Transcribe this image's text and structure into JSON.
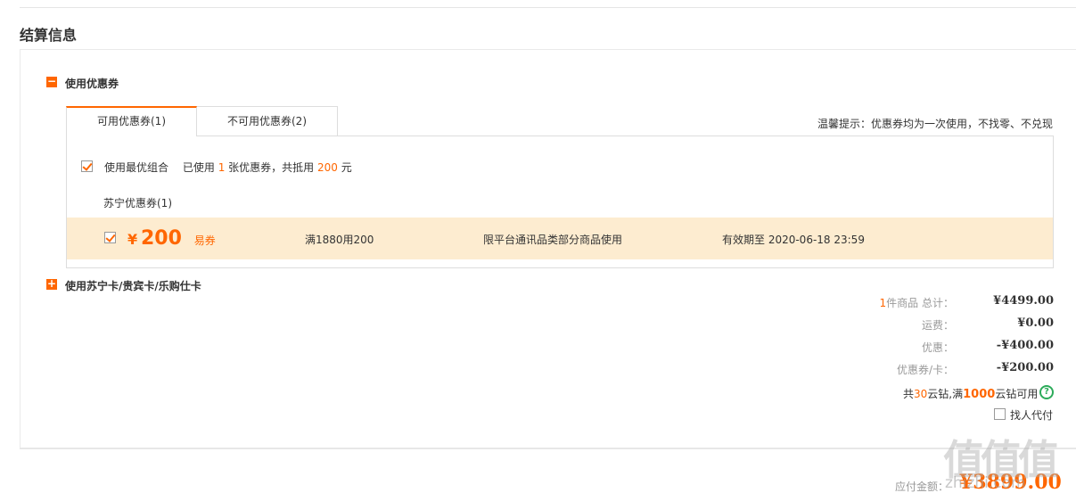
{
  "section": {
    "title": "结算信息"
  },
  "coupon_section": {
    "toggle_symbol": "−",
    "label": "使用优惠券",
    "tabs": [
      {
        "label": "可用优惠券(1)",
        "active": true
      },
      {
        "label": "不可用优惠券(2)",
        "active": false
      }
    ],
    "hint": "温馨提示：优惠券均为一次使用，不找零、不兑现",
    "best_combo": {
      "label": "使用最优组合",
      "used_prefix": "已使用",
      "used_count": "1",
      "used_mid": "张优惠券，共抵用",
      "used_amount": "200",
      "used_suffix": "元",
      "checked": true
    },
    "group_title": "苏宁优惠券(1)",
    "coupon": {
      "checked": true,
      "yen": "¥",
      "amount": "200",
      "tag": "易券",
      "condition": "满1880用200",
      "scope": "限平台通讯品类部分商品使用",
      "validity": "有效期至 2020-06-18 23:59"
    }
  },
  "card_section": {
    "toggle_symbol": "+",
    "label": "使用苏宁卡/贵宾卡/乐购仕卡"
  },
  "summary": {
    "items_count": "1",
    "items_label": "件商品 总计：",
    "items_total": "¥4499.00",
    "shipping_label": "运费：",
    "shipping": "¥0.00",
    "discount_label": "优惠：",
    "discount": "-¥400.00",
    "coupon_label": "优惠券/卡：",
    "coupon": "-¥200.00",
    "yunzuan_prefix": "共",
    "yunzuan_count": "30",
    "yunzuan_mid": "云钻,满",
    "yunzuan_threshold": "1000",
    "yunzuan_suffix": "云钻可用",
    "help_symbol": "?",
    "proxy_pay_label": "找人代付"
  },
  "payment": {
    "label": "应付金额：",
    "amount": "¥3899.00"
  },
  "watermark": {
    "glyphs": "值值值",
    "site": "zhizhi.com"
  },
  "colors": {
    "accent": "#ff6600",
    "coupon_bg": "#fdecd0",
    "help_green": "#2cab5a"
  }
}
